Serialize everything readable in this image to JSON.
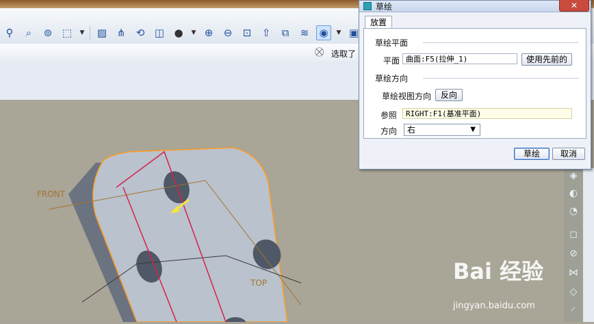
{
  "toolbar": {
    "icons": [
      "selection-filter-icon",
      "search-icon",
      "binoculars-icon",
      "select-box-icon",
      "chevron-down-icon",
      "sketch-icon",
      "datum-point-icon",
      "refit-icon",
      "view-manager-icon",
      "shade-icon",
      "zoom-in-icon",
      "zoom-out-icon",
      "zoom-fit-icon",
      "orient-icon",
      "named-views-icon",
      "layers-icon",
      "display-style-icon",
      "chevron-down-icon",
      "camera-icon"
    ]
  },
  "status": {
    "selection_text": "选取了"
  },
  "dialog": {
    "title": "草绘",
    "tab_label": "放置",
    "sketch_plane_group": "草绘平面",
    "plane_label": "平面",
    "plane_value": "曲面:F5(拉伸_1)",
    "use_previous_label": "使用先前的",
    "sketch_orientation_group": "草绘方向",
    "view_direction_label": "草绘视图方向",
    "flip_label": "反向",
    "reference_label": "参照",
    "reference_value": "RIGHT:F1(基准平面)",
    "direction_label": "方向",
    "direction_value": "右",
    "sketch_button": "草绘",
    "cancel_button": "取消"
  },
  "viewport": {
    "front_label": "FRONT",
    "top_label": "TOP"
  },
  "watermark": {
    "brand": "Bai 经验",
    "url": "jingyan.baidu.com"
  }
}
